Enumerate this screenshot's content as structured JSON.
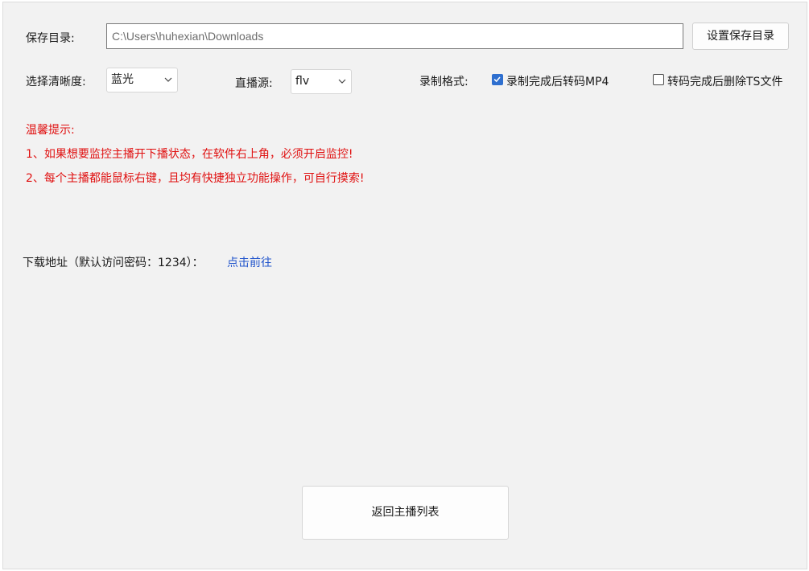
{
  "save_dir": {
    "label": "保存目录:",
    "path": "C:\\Users\\huhexian\\Downloads",
    "button": "设置保存目录"
  },
  "options": {
    "quality_label": "选择清晰度:",
    "quality_value": "蓝光",
    "source_label": "直播源:",
    "source_value": "flv",
    "format_label": "录制格式:",
    "convert_mp4": {
      "label": "录制完成后转码MP4",
      "checked": true
    },
    "delete_ts": {
      "label": "转码完成后删除TS文件",
      "checked": false
    }
  },
  "tips": {
    "title": "温馨提示:",
    "line1": "1、如果想要监控主播开下播状态，在软件右上角，必须开启监控!",
    "line2": "2、每个主播都能鼠标右键，且均有快捷独立功能操作，可自行摸索!"
  },
  "download": {
    "label": "下载地址（默认访问密码：1234）：",
    "link": "点击前往"
  },
  "back_button": "返回主播列表",
  "colors": {
    "tip_red": "#e01010",
    "link_blue": "#2255cc",
    "check_blue": "#2e6fcf",
    "panel_bg": "#f2f2f2"
  }
}
